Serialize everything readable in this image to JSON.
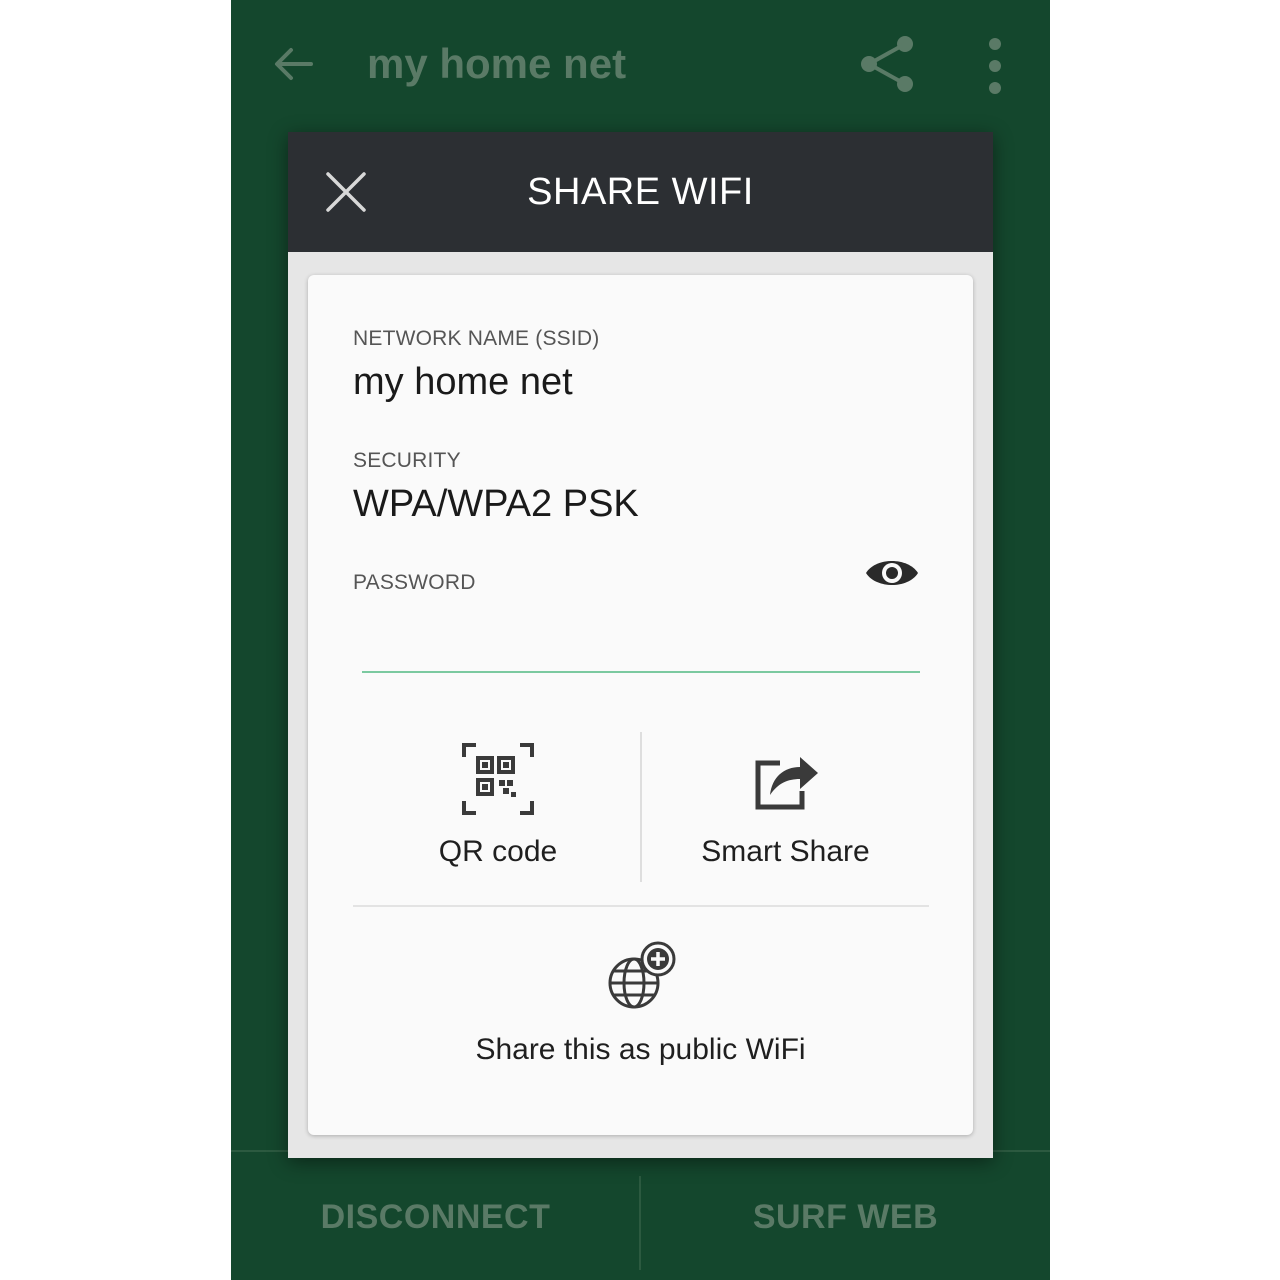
{
  "app_bar": {
    "title": "my home net",
    "back_icon": "arrow-left-icon",
    "share_icon": "share-icon",
    "more_icon": "more-vertical-icon"
  },
  "dialog": {
    "title": "SHARE WIFI",
    "close_icon": "close-icon",
    "network_name_label": "NETWORK NAME (SSID)",
    "network_name": "my home net",
    "security_label": "SECURITY",
    "security": "WPA/WPA2 PSK",
    "password_label": "PASSWORD",
    "password_value": "",
    "show_password_icon": "eye-icon",
    "options": {
      "qr_label": "QR code",
      "qr_icon": "qr-code-icon",
      "smart_share_label": "Smart Share",
      "smart_share_icon": "share-arrow-icon",
      "public_wifi_label": "Share this as public WiFi",
      "public_wifi_icon": "globe-plus-icon"
    }
  },
  "bottom_bar": {
    "disconnect": "DISCONNECT",
    "surf_web": "SURF WEB"
  },
  "colors": {
    "background": "#14472d",
    "dialog_header": "#2c2f33",
    "accent_line": "#7bc9a0"
  }
}
